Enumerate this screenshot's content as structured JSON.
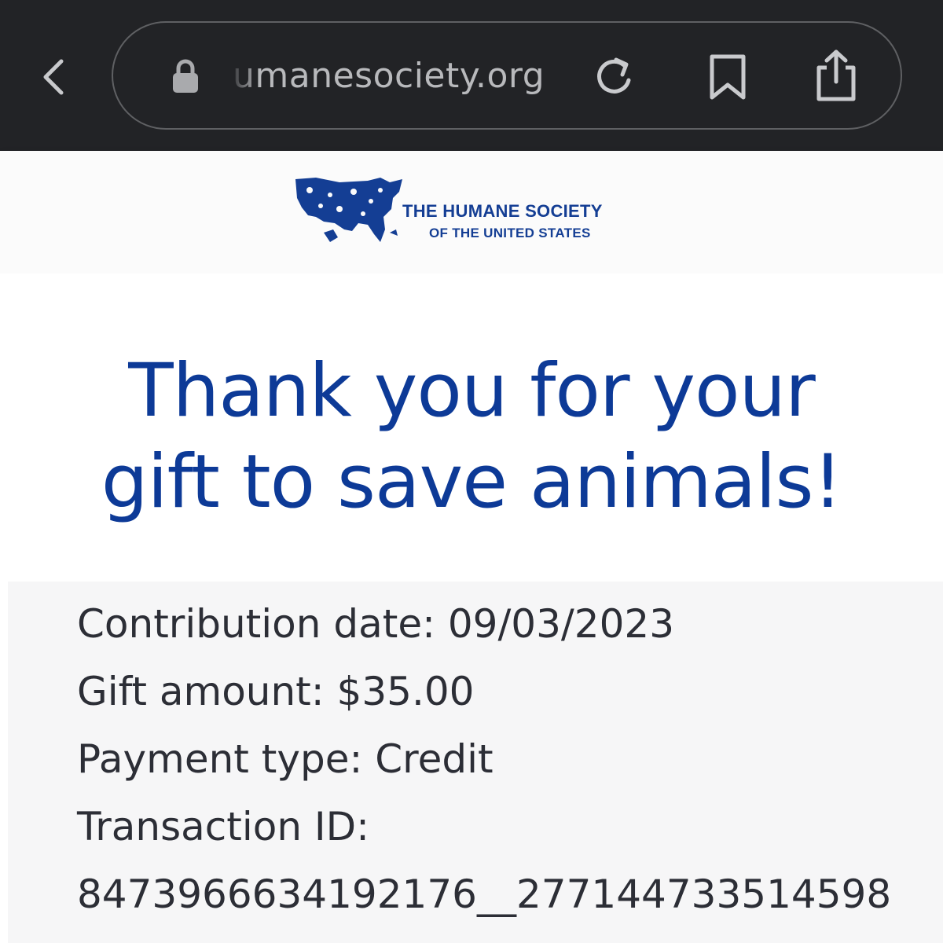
{
  "browser": {
    "url": "umanesociety.org",
    "icons": {
      "back": "chevron-left-icon",
      "lock": "lock-icon",
      "reload": "reload-icon",
      "bookmark": "bookmark-icon",
      "share": "share-icon"
    }
  },
  "header": {
    "logo_line1": "THE HUMANE SOCIETY",
    "logo_line2": "OF THE UNITED STATES",
    "brand_color": "#143e94"
  },
  "main": {
    "headline_line1": "Thank you for your",
    "headline_line2": "gift to save animals!",
    "headline_color": "#0d3a97"
  },
  "details": {
    "contribution_date": "Contribution date: 09/03/2023",
    "gift_amount": "Gift amount: $35.00",
    "payment_type": "Payment type: Credit",
    "transaction_id_label": "Transaction ID:",
    "transaction_id_value": "8473966634192176__277144733514598"
  }
}
